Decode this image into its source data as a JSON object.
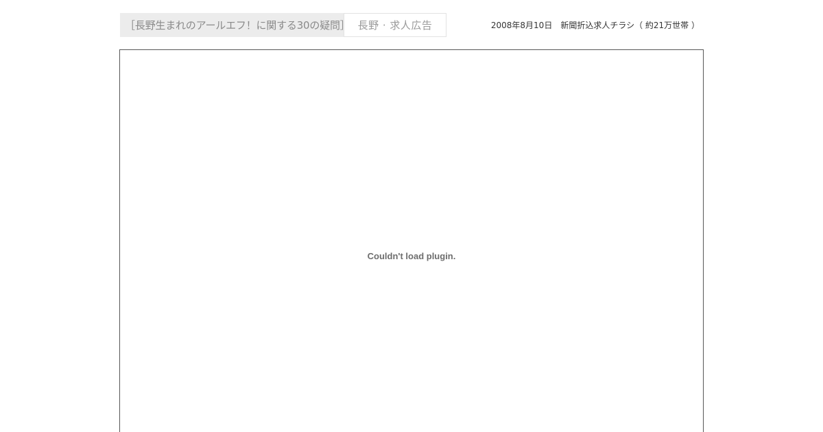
{
  "tabs": [
    {
      "label": "［長野生まれのアールエフ！に関する30の疑問］",
      "active": true
    },
    {
      "label": "長野 · 求人広告",
      "active": false
    }
  ],
  "header": {
    "date": "2008年8月10日",
    "description": "新聞折込求人チラシ（ 約21万世帯 ）"
  },
  "plugin": {
    "message": "Couldn't load plugin."
  }
}
